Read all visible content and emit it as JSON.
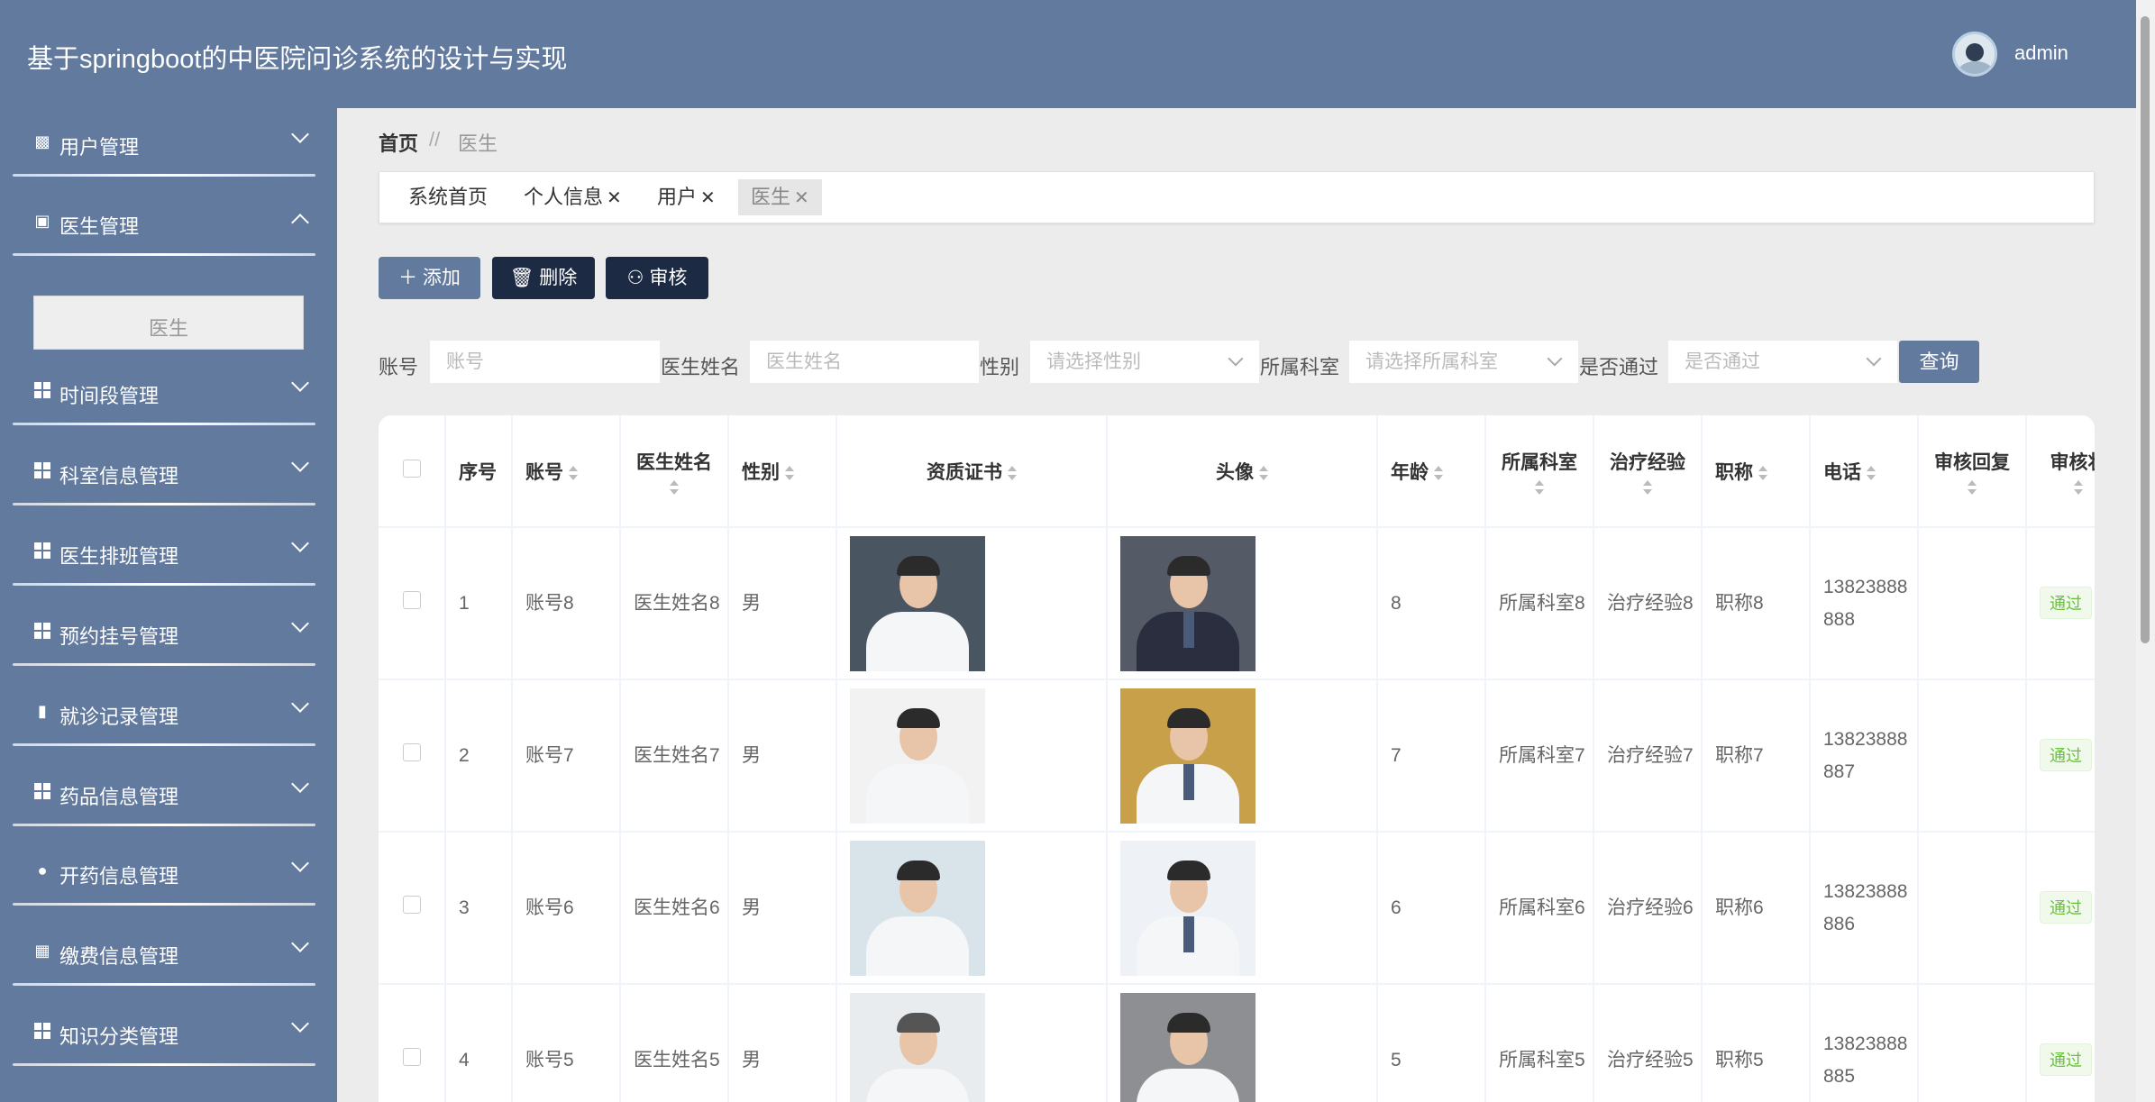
{
  "app": {
    "title": "基于springboot的中医院问诊系统的设计与实现",
    "username": "admin"
  },
  "colors": {
    "primary": "#637a9f",
    "dark_button": "#1d2a44",
    "pass_badge": "#67c23a"
  },
  "sidebar": {
    "items": [
      {
        "label": "用户管理",
        "icon": "clipboard-user-icon",
        "expanded": false
      },
      {
        "label": "医生管理",
        "icon": "briefcase-icon",
        "expanded": true
      },
      {
        "label": "时间段管理",
        "icon": "grid-icon",
        "expanded": false
      },
      {
        "label": "科室信息管理",
        "icon": "grid-icon",
        "expanded": false
      },
      {
        "label": "医生排班管理",
        "icon": "grid-icon",
        "expanded": false
      },
      {
        "label": "预约挂号管理",
        "icon": "grid-icon",
        "expanded": false
      },
      {
        "label": "就诊记录管理",
        "icon": "chat-icon",
        "expanded": false
      },
      {
        "label": "药品信息管理",
        "icon": "grid-icon",
        "expanded": false
      },
      {
        "label": "开药信息管理",
        "icon": "user-icon",
        "expanded": false
      },
      {
        "label": "缴费信息管理",
        "icon": "wallet-icon",
        "expanded": false
      },
      {
        "label": "知识分类管理",
        "icon": "grid-icon",
        "expanded": false
      }
    ],
    "submenu_active": "医生"
  },
  "breadcrumb": {
    "home": "首页",
    "separator": "//",
    "current": "医生"
  },
  "tabs": [
    {
      "label": "系统首页",
      "closable": false
    },
    {
      "label": "个人信息",
      "closable": true
    },
    {
      "label": "用户",
      "closable": true
    },
    {
      "label": "医生",
      "closable": true,
      "active": true
    }
  ],
  "toolbar": {
    "add": "添加",
    "delete": "删除",
    "audit": "审核"
  },
  "filters": {
    "account_label": "账号",
    "account_placeholder": "账号",
    "name_label": "医生姓名",
    "name_placeholder": "医生姓名",
    "gender_label": "性别",
    "gender_placeholder": "请选择性别",
    "dept_label": "所属科室",
    "dept_placeholder": "请选择所属科室",
    "pass_label": "是否通过",
    "pass_placeholder": "是否通过",
    "query": "查询"
  },
  "table": {
    "headers": {
      "index": "序号",
      "account": "账号",
      "name": "医生姓名",
      "gender": "性别",
      "certificate": "资质证书",
      "avatar": "头像",
      "age": "年龄",
      "dept": "所属科室",
      "experience": "治疗经验",
      "title": "职称",
      "phone": "电话",
      "reply": "审核回复",
      "status": "审核状"
    },
    "rows": [
      {
        "index": "1",
        "account": "账号8",
        "name": "医生姓名8",
        "gender": "男",
        "age": "8",
        "dept": "所属科室8",
        "experience": "治疗经验8",
        "title": "职称8",
        "phone": "13823888888",
        "reply": "",
        "status": "通过"
      },
      {
        "index": "2",
        "account": "账号7",
        "name": "医生姓名7",
        "gender": "男",
        "age": "7",
        "dept": "所属科室7",
        "experience": "治疗经验7",
        "title": "职称7",
        "phone": "13823888887",
        "reply": "",
        "status": "通过"
      },
      {
        "index": "3",
        "account": "账号6",
        "name": "医生姓名6",
        "gender": "男",
        "age": "6",
        "dept": "所属科室6",
        "experience": "治疗经验6",
        "title": "职称6",
        "phone": "13823888886",
        "reply": "",
        "status": "通过"
      },
      {
        "index": "4",
        "account": "账号5",
        "name": "医生姓名5",
        "gender": "男",
        "age": "5",
        "dept": "所属科室5",
        "experience": "治疗经验5",
        "title": "职称5",
        "phone": "13823888885",
        "reply": "",
        "status": "通过"
      }
    ]
  }
}
